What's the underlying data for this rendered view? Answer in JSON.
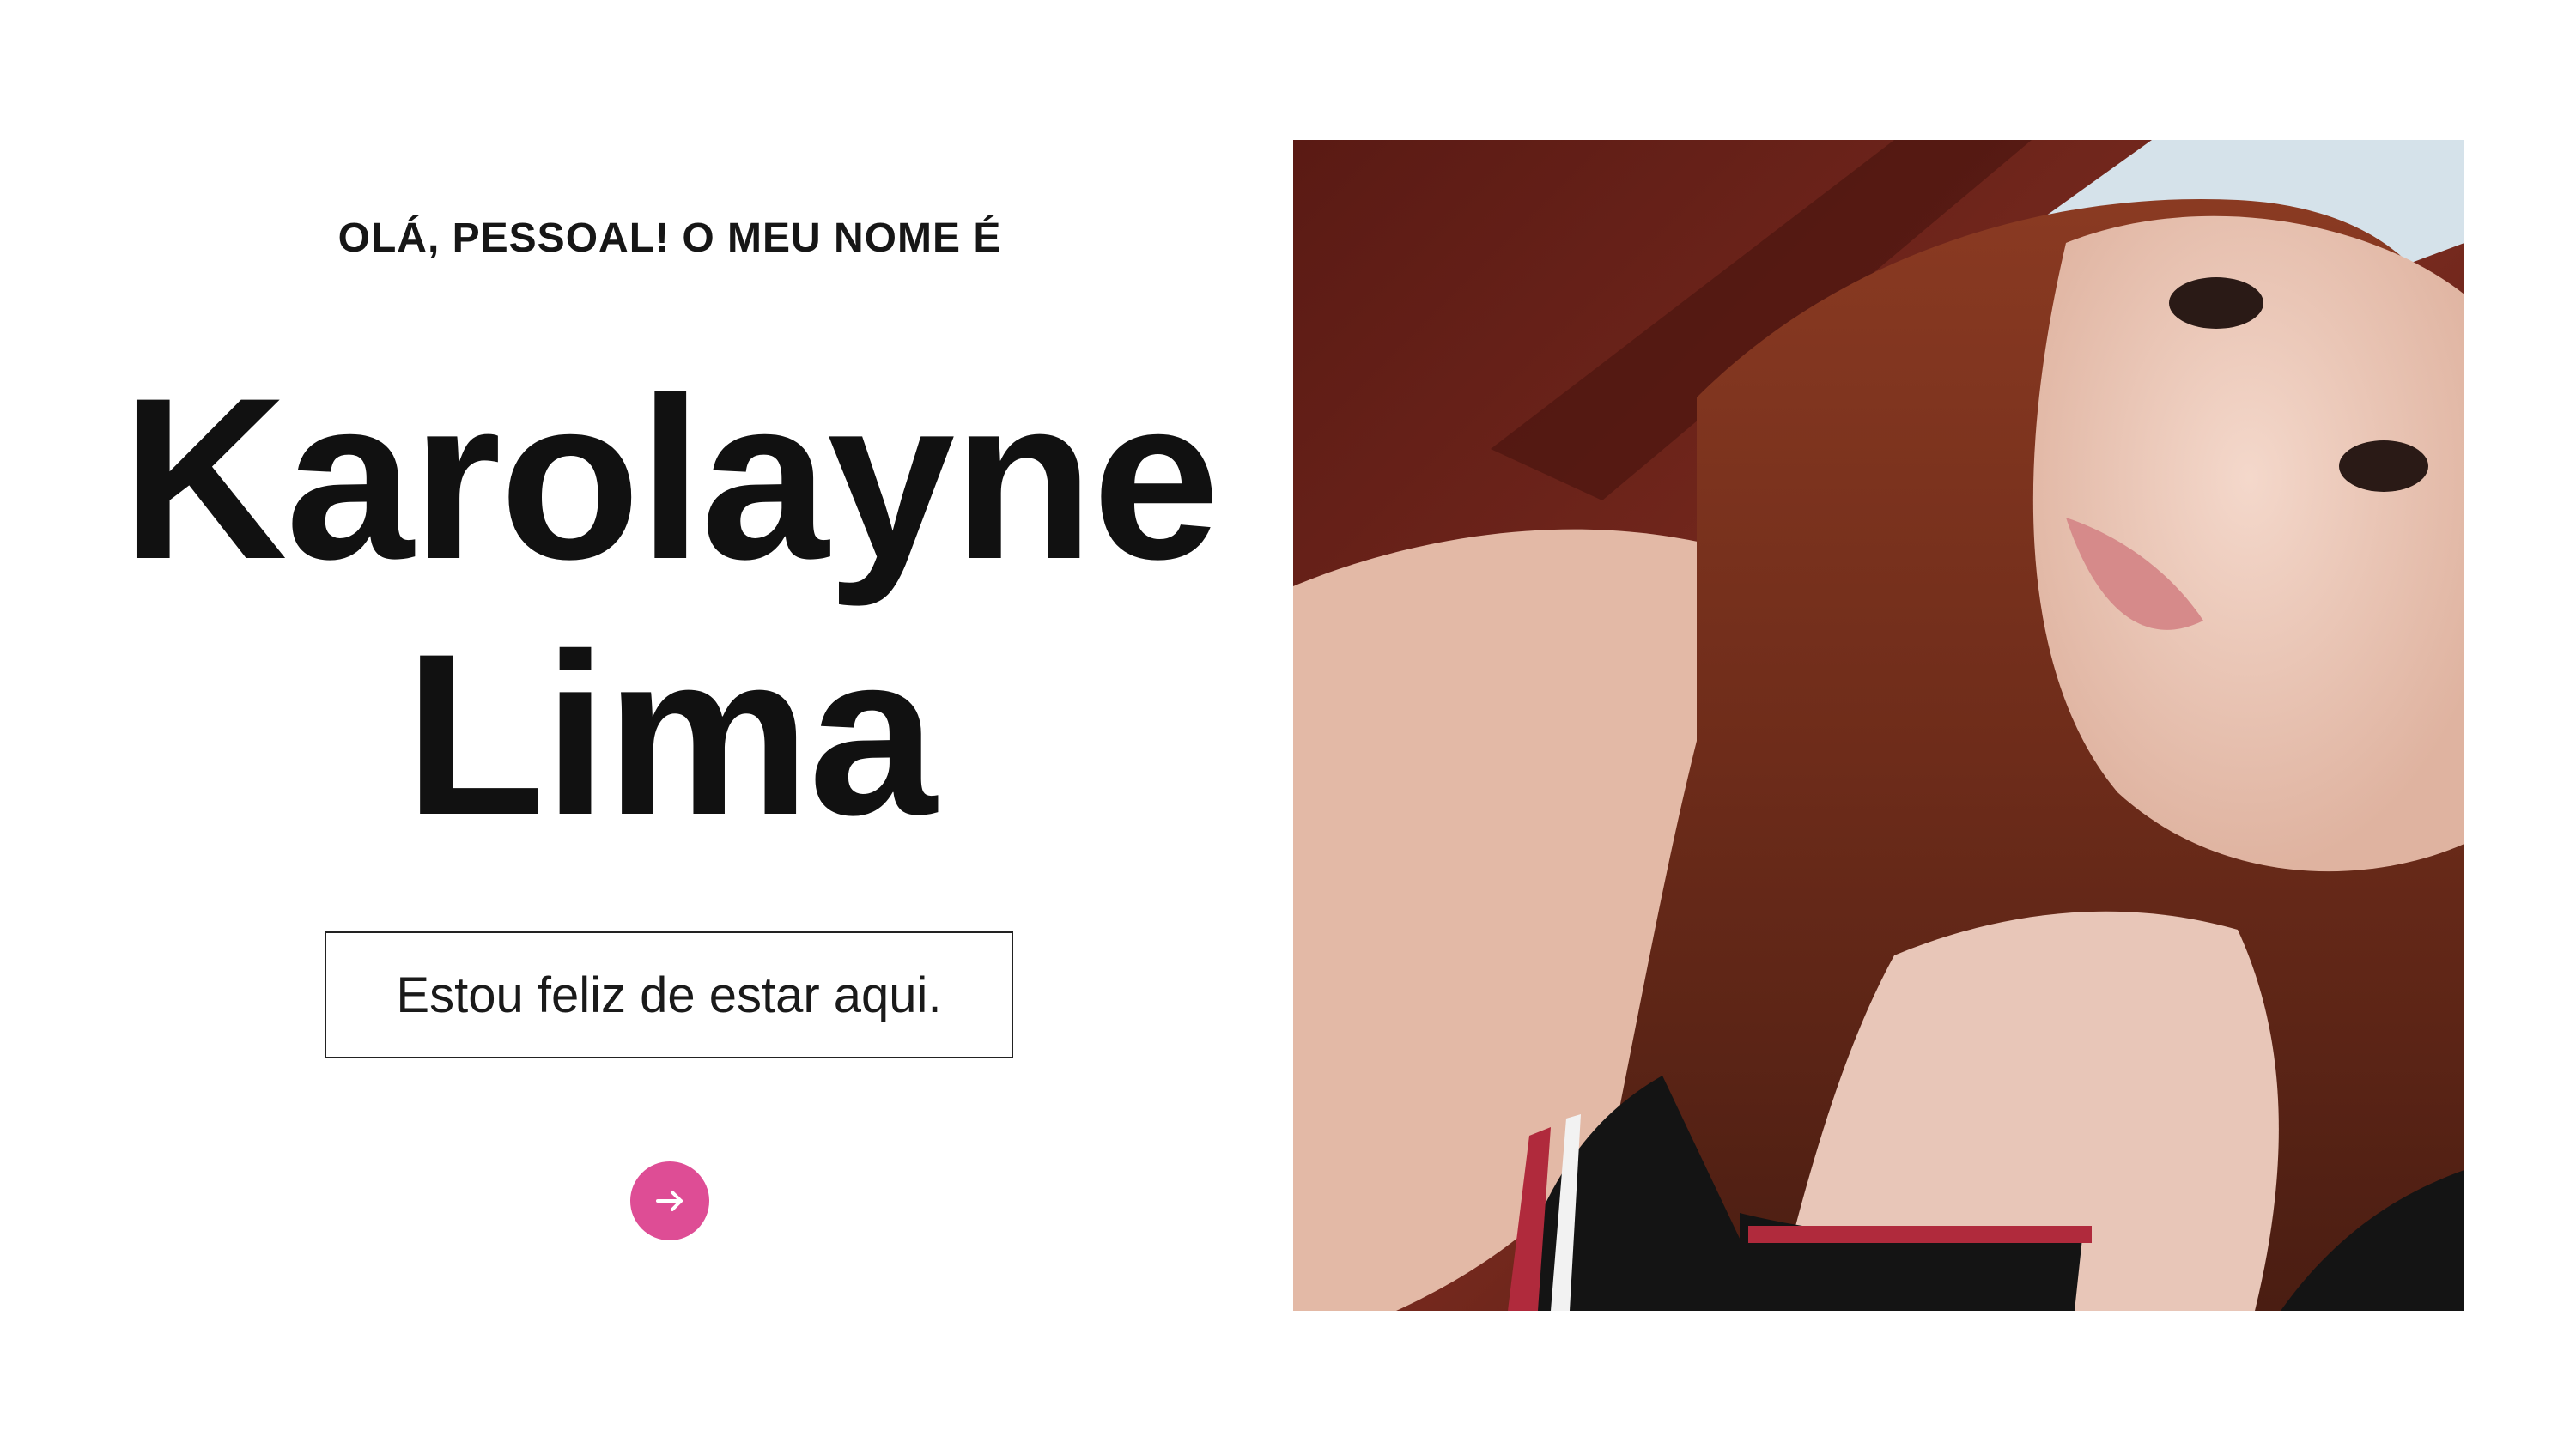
{
  "intro": {
    "greeting": "OLÁ, PESSOAL! O MEU NOME É",
    "first_name": "Karolayne",
    "last_name": "Lima",
    "tagline": "Estou feliz de estar aqui."
  },
  "navigation": {
    "next_icon": "arrow-right-icon"
  },
  "colors": {
    "accent": "#de4d95",
    "text": "#111111",
    "background": "#ffffff"
  }
}
